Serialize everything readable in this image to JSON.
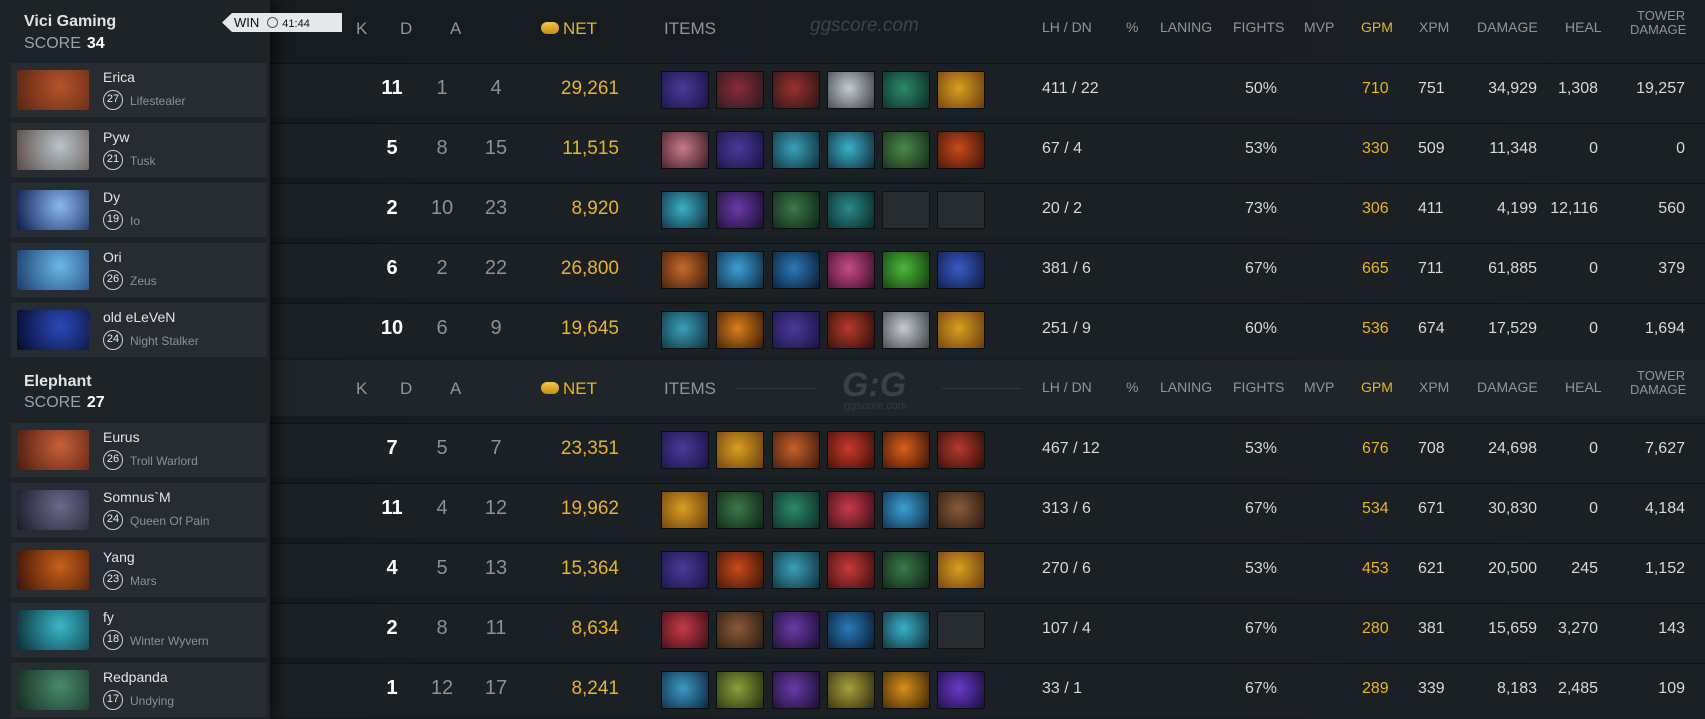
{
  "teams": [
    {
      "name": "Vici Gaming",
      "score_label": "SCORE",
      "score": "34",
      "result": "WIN",
      "duration": "41:44",
      "players": [
        {
          "name": "Erica",
          "level": "27",
          "hero": "Lifestealer",
          "k": "11",
          "d": "1",
          "a": "4",
          "net": "29,261",
          "lhdn": "411  /  22",
          "pct": "",
          "laning": "",
          "fights": "50%",
          "mvp": "",
          "gpm": "710",
          "xpm": "751",
          "damage": "34,929",
          "heal": "1,308",
          "tower": "19,257",
          "portrait": [
            "#b4542a",
            "#5a2412"
          ],
          "items": [
            [
              "#4a3a9a",
              "#1b1245"
            ],
            [
              "#8a2a3a",
              "#2a1a1e"
            ],
            [
              "#9a3030",
              "#2a1414"
            ],
            [
              "#c6cbcf",
              "#3a4046"
            ],
            [
              "#2a8a6a",
              "#0d2a24"
            ],
            [
              "#d8a020",
              "#6a3a10"
            ]
          ]
        },
        {
          "name": "Pyw",
          "level": "21",
          "hero": "Tusk",
          "k": "5",
          "d": "8",
          "a": "15",
          "net": "11,515",
          "lhdn": "67  /  4",
          "pct": "",
          "laning": "",
          "fights": "53%",
          "mvp": "",
          "gpm": "330",
          "xpm": "509",
          "damage": "11,348",
          "heal": "0",
          "tower": "0",
          "portrait": [
            "#b8c4cc",
            "#5a4a44"
          ],
          "items": [
            [
              "#c87a8a",
              "#3a1a22"
            ],
            [
              "#4a3a9a",
              "#1b1245"
            ],
            [
              "#3aa0b8",
              "#0e2e3a"
            ],
            [
              "#3ab0c8",
              "#0e2a36"
            ],
            [
              "#4a8a4a",
              "#142a18"
            ],
            [
              "#c84a1a",
              "#3a1408"
            ]
          ]
        },
        {
          "name": "Dy",
          "level": "19",
          "hero": "Io",
          "k": "2",
          "d": "10",
          "a": "23",
          "net": "8,920",
          "lhdn": "20  /  2",
          "pct": "",
          "laning": "",
          "fights": "73%",
          "mvp": "",
          "gpm": "306",
          "xpm": "411",
          "damage": "4,199",
          "heal": "12,116",
          "tower": "560",
          "portrait": [
            "#8ab8f0",
            "#0a1a4a"
          ],
          "items": [
            [
              "#3ab0c8",
              "#0e2a36"
            ],
            [
              "#6a3aa8",
              "#1a0e30"
            ],
            [
              "#3a7a4a",
              "#0e2214"
            ],
            [
              "#2a8a8a",
              "#0a2626"
            ],
            null,
            null
          ]
        },
        {
          "name": "Ori",
          "level": "26",
          "hero": "Zeus",
          "k": "6",
          "d": "2",
          "a": "22",
          "net": "26,800",
          "lhdn": "381  /  6",
          "pct": "",
          "laning": "",
          "fights": "67%",
          "mvp": "",
          "gpm": "665",
          "xpm": "711",
          "damage": "61,885",
          "heal": "0",
          "tower": "379",
          "portrait": [
            "#6ab8e8",
            "#1a3a6a"
          ],
          "items": [
            [
              "#c86a2a",
              "#3a1a0a"
            ],
            [
              "#3aa0d8",
              "#0e2a3e"
            ],
            [
              "#2a7ab8",
              "#0a1a30"
            ],
            [
              "#c84a8a",
              "#3a0e26"
            ],
            [
              "#4ab83a",
              "#143a0e"
            ],
            [
              "#3a5ac8",
              "#0e1a3a"
            ]
          ]
        },
        {
          "name": "old eLeVeN",
          "level": "24",
          "hero": "Night Stalker",
          "k": "10",
          "d": "6",
          "a": "9",
          "net": "19,645",
          "lhdn": "251  /  9",
          "pct": "",
          "laning": "",
          "fights": "60%",
          "mvp": "",
          "gpm": "536",
          "xpm": "674",
          "damage": "17,529",
          "heal": "0",
          "tower": "1,694",
          "portrait": [
            "#2a4ab8",
            "#060a2a"
          ],
          "items": [
            [
              "#3aa0b8",
              "#0e2e3a"
            ],
            [
              "#d8801a",
              "#3a1a06"
            ],
            [
              "#4a3a9a",
              "#1b1245"
            ],
            [
              "#b83a2a",
              "#2a0e0a"
            ],
            [
              "#c6cbcf",
              "#3a4046"
            ],
            [
              "#d8a020",
              "#6a3a10"
            ]
          ]
        }
      ]
    },
    {
      "name": "Elephant",
      "score_label": "SCORE",
      "score": "27",
      "players": [
        {
          "name": "Eurus",
          "level": "26",
          "hero": "Troll Warlord",
          "k": "7",
          "d": "5",
          "a": "7",
          "net": "23,351",
          "lhdn": "467  /  12",
          "pct": "",
          "laning": "",
          "fights": "53%",
          "mvp": "",
          "gpm": "676",
          "xpm": "708",
          "damage": "24,698",
          "heal": "0",
          "tower": "7,627",
          "portrait": [
            "#c8603a",
            "#4a1a0e"
          ],
          "items": [
            [
              "#4a3a9a",
              "#1b1245"
            ],
            [
              "#d8a020",
              "#6a3a10"
            ],
            [
              "#c8602a",
              "#3a1a0a"
            ],
            [
              "#c83a2a",
              "#3a0e0a"
            ],
            [
              "#d8601a",
              "#3a1206"
            ],
            [
              "#b83a2a",
              "#2a0e0a"
            ]
          ]
        },
        {
          "name": "Somnus`M",
          "level": "24",
          "hero": "Queen Of Pain",
          "k": "11",
          "d": "4",
          "a": "12",
          "net": "19,962",
          "lhdn": "313  /  6",
          "pct": "",
          "laning": "",
          "fights": "67%",
          "mvp": "",
          "gpm": "534",
          "xpm": "671",
          "damage": "30,830",
          "heal": "0",
          "tower": "4,184",
          "portrait": [
            "#6a6a8a",
            "#1a1a2a"
          ],
          "items": [
            [
              "#d8a020",
              "#6a3a10"
            ],
            [
              "#3a7a4a",
              "#0e2214"
            ],
            [
              "#2a8a6a",
              "#0d2a24"
            ],
            [
              "#c83a4a",
              "#3a0e14"
            ],
            [
              "#3aa0d8",
              "#0e2a3e"
            ],
            [
              "#8a5a3a",
              "#2a1a10"
            ]
          ]
        },
        {
          "name": "Yang",
          "level": "23",
          "hero": "Mars",
          "k": "4",
          "d": "5",
          "a": "13",
          "net": "15,364",
          "lhdn": "270  /  6",
          "pct": "",
          "laning": "",
          "fights": "53%",
          "mvp": "",
          "gpm": "453",
          "xpm": "621",
          "damage": "20,500",
          "heal": "245",
          "tower": "1,152",
          "portrait": [
            "#c8601a",
            "#3a1206"
          ],
          "items": [
            [
              "#4a3a9a",
              "#1b1245"
            ],
            [
              "#c84a1a",
              "#3a1408"
            ],
            [
              "#3aa0b8",
              "#0e2e3a"
            ],
            [
              "#c83a3a",
              "#3a0e0e"
            ],
            [
              "#3a7a4a",
              "#0e2214"
            ],
            [
              "#d8a020",
              "#6a3a10"
            ]
          ]
        },
        {
          "name": "fy",
          "level": "18",
          "hero": "Winter Wyvern",
          "k": "2",
          "d": "8",
          "a": "11",
          "net": "8,634",
          "lhdn": "107  /  4",
          "pct": "",
          "laning": "",
          "fights": "67%",
          "mvp": "",
          "gpm": "280",
          "xpm": "381",
          "damage": "15,659",
          "heal": "3,270",
          "tower": "143",
          "portrait": [
            "#3ab8c8",
            "#0a2a34"
          ],
          "items": [
            [
              "#c83a4a",
              "#3a0e14"
            ],
            [
              "#8a5a3a",
              "#2a1a10"
            ],
            [
              "#6a3aa8",
              "#1a0e30"
            ],
            [
              "#2a7ab8",
              "#0a1a30"
            ],
            [
              "#3ab0c8",
              "#0e2a36"
            ],
            null
          ]
        },
        {
          "name": "Redpanda",
          "level": "17",
          "hero": "Undying",
          "k": "1",
          "d": "12",
          "a": "17",
          "net": "8,241",
          "lhdn": "33  /  1",
          "pct": "",
          "laning": "",
          "fights": "67%",
          "mvp": "",
          "gpm": "289",
          "xpm": "339",
          "damage": "8,183",
          "heal": "2,485",
          "tower": "109",
          "portrait": [
            "#4a8a6a",
            "#142a20"
          ],
          "items": [
            [
              "#3a9ac8",
              "#0e263a"
            ],
            [
              "#8aa03a",
              "#262e0e"
            ],
            [
              "#6a3aa8",
              "#1a0e30"
            ],
            [
              "#a8a03a",
              "#2e2a0e"
            ],
            [
              "#d8901a",
              "#3a2406"
            ],
            [
              "#6a3ac8",
              "#1a0e3a"
            ]
          ]
        }
      ]
    }
  ],
  "columns": {
    "k": "K",
    "d": "D",
    "a": "A",
    "net": "NET",
    "items": "ITEMS",
    "lhdn": "LH  /  DN",
    "pct": "%",
    "laning": "LANING",
    "fights": "FIGHTS",
    "mvp": "MVP",
    "gpm": "GPM",
    "xpm": "XPM",
    "damage": "DAMAGE",
    "heal": "HEAL",
    "tower_line1": "TOWER",
    "tower_line2": "DAMAGE"
  },
  "watermark": {
    "site": "ggscore.com",
    "logo": "G:G",
    "sub": "ggscore.com"
  },
  "colors": {
    "gold": "#e8b22d",
    "panel": "#1e2327",
    "row": "#1b2024"
  }
}
